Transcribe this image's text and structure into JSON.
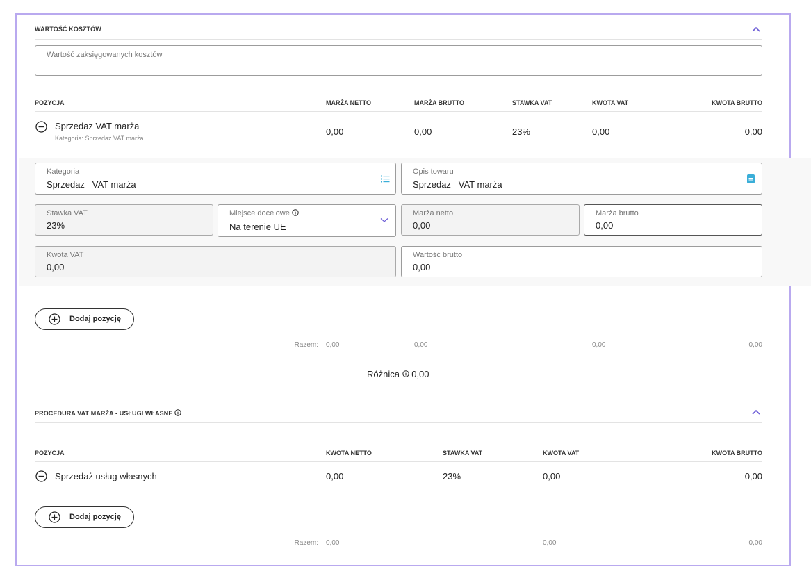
{
  "section1": {
    "title": "WARTOŚĆ KOSZTÓW",
    "costs_field": {
      "placeholder": "Wartość zaksięgowanych kosztów",
      "value": ""
    },
    "columns": [
      "POZYCJA",
      "MARŻA NETTO",
      "MARŻA BRUTTO",
      "STAWKA VAT",
      "KWOTA VAT",
      "KWOTA BRUTTO"
    ],
    "row": {
      "name": "Sprzedaz VAT marża",
      "category_line": "Kategoria: Sprzedaz VAT marża",
      "marza_netto": "0,00",
      "marza_brutto": "0,00",
      "stawka_vat": "23%",
      "kwota_vat": "0,00",
      "kwota_brutto": "0,00"
    },
    "form": {
      "kategoria": {
        "label": "Kategoria",
        "value": "Sprzedaz   VAT marża",
        "icon": "list-icon"
      },
      "opis": {
        "label": "Opis towaru",
        "value": "Sprzedaz   VAT marża",
        "icon": "note-icon"
      },
      "stawka": {
        "label": "Stawka VAT",
        "value": "23%"
      },
      "miejsce": {
        "label": "Miejsce docelowe",
        "value": "Na terenie UE"
      },
      "marza_netto": {
        "label": "Marża netto",
        "value": "0,00"
      },
      "marza_brutto": {
        "label": "Marża brutto",
        "value": "0,00"
      },
      "kwota_vat": {
        "label": "Kwota VAT",
        "value": "0,00"
      },
      "wartosc_brutto": {
        "label": "Wartość brutto",
        "value": "0,00"
      }
    },
    "add_button": "Dodaj pozycję",
    "totals": {
      "label": "Razem:",
      "marza_netto": "0,00",
      "marza_brutto": "0,00",
      "kwota_vat": "0,00",
      "kwota_brutto": "0,00"
    },
    "roznica": {
      "label": "Różnica",
      "value": "0,00"
    }
  },
  "section2": {
    "title": "PROCEDURA VAT MARŻA - USŁUGI WŁASNE",
    "columns": [
      "POZYCJA",
      "KWOTA NETTO",
      "STAWKA VAT",
      "KWOTA VAT",
      "KWOTA BRUTTO"
    ],
    "row": {
      "name": "Sprzedaż usług własnych",
      "kwota_netto": "0,00",
      "stawka_vat": "23%",
      "kwota_vat": "0,00",
      "kwota_brutto": "0,00"
    },
    "add_button": "Dodaj pozycję",
    "totals": {
      "label": "Razem:",
      "kwota_netto": "0,00",
      "kwota_vat": "0,00",
      "kwota_brutto": "0,00"
    }
  },
  "colors": {
    "accent": "#6b5bd6",
    "frame": "#b9a9ef",
    "icon_teal": "#3aaed8"
  }
}
